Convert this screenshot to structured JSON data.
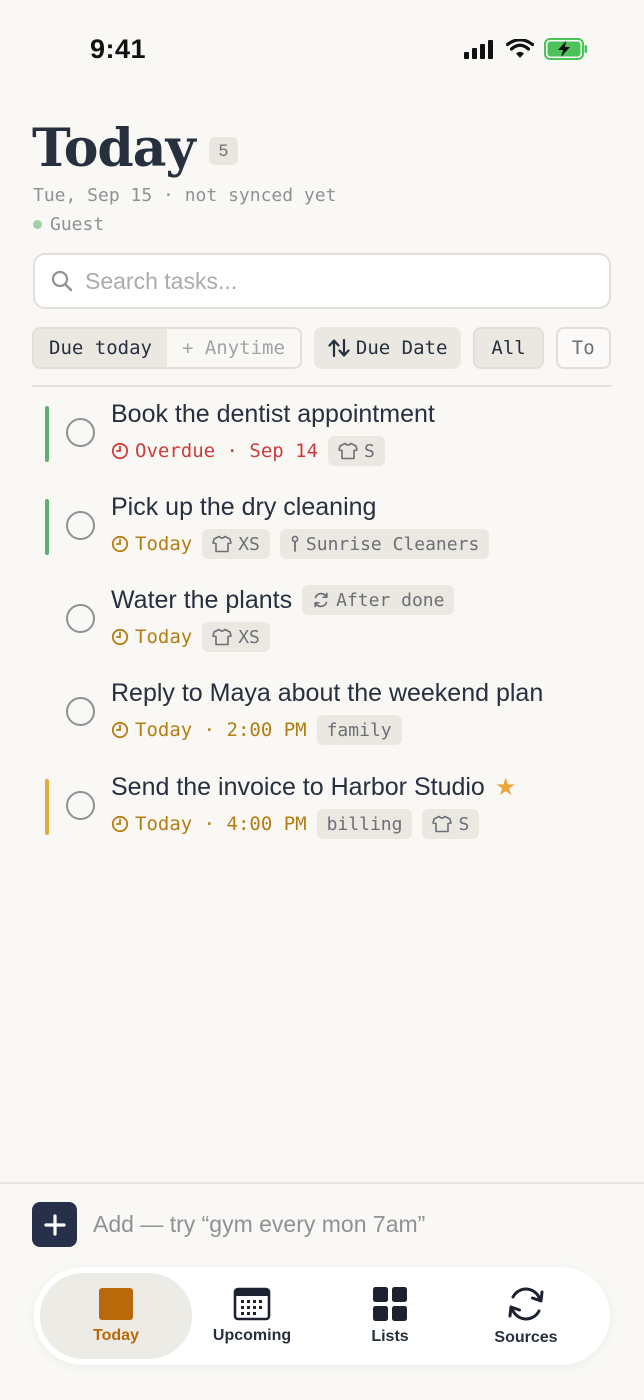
{
  "status_bar": {
    "time": "9:41"
  },
  "header": {
    "title": "Today",
    "count": "5",
    "subtitle": "Tue, Sep 15 · not synced yet",
    "user": "Guest"
  },
  "search": {
    "placeholder": "Search tasks..."
  },
  "filters": {
    "due_today": "Due today",
    "anytime": "+ Anytime",
    "sort": "Due Date",
    "all": "All",
    "next": "To"
  },
  "tasks": [
    {
      "title": "Book the dentist appointment",
      "meta": "Overdue · Sep 14",
      "tag": "S"
    },
    {
      "title": "Pick up the dry cleaning",
      "meta": "Today",
      "tag": "XS",
      "location": "Sunrise Cleaners"
    },
    {
      "title": "Water the plants",
      "repeat": "After done",
      "meta": "Today",
      "tag": "XS"
    },
    {
      "title": "Reply to Maya about the weekend plan",
      "meta": "Today · 2:00 PM",
      "label": "family"
    },
    {
      "title": "Send the invoice to Harbor Studio",
      "meta": "Today · 4:00 PM",
      "label": "billing",
      "tag": "S"
    }
  ],
  "add": {
    "placeholder": "Add — try “gym every mon 7am”"
  },
  "tabs": [
    {
      "label": "Today"
    },
    {
      "label": "Upcoming"
    },
    {
      "label": "Lists"
    },
    {
      "label": "Sources"
    }
  ],
  "colors": {
    "accent": "#b8690a",
    "overdue": "#cf3b3b",
    "today": "#b67c12",
    "bar_green": "#5fb06e",
    "bar_orange": "#e9a83a"
  }
}
